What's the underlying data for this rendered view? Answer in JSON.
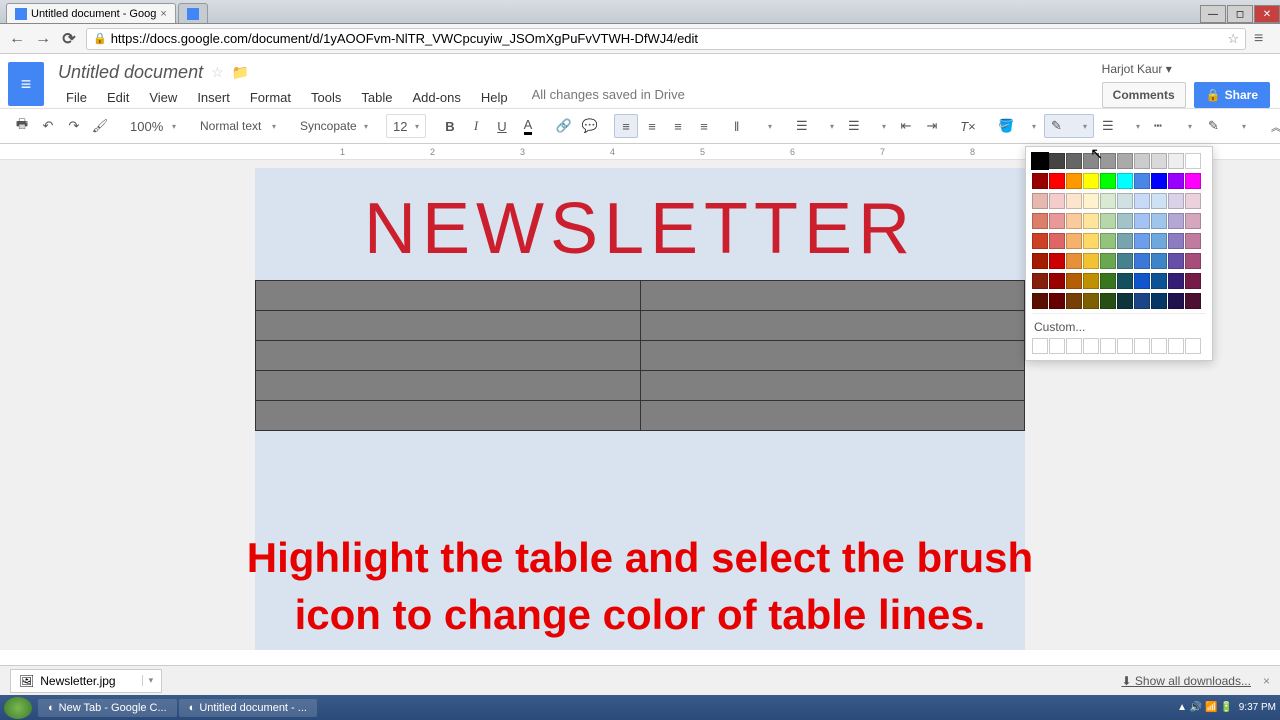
{
  "browser": {
    "tabs": [
      {
        "title": "Untitled document - Goog",
        "active": true
      }
    ],
    "url": "https://docs.google.com/document/d/1yAOOFvm-NlTR_VWCpcuyiw_JSOmXgPuFvVTWH-DfWJ4/edit"
  },
  "docs": {
    "title": "Untitled document",
    "menus": [
      "File",
      "Edit",
      "View",
      "Insert",
      "Format",
      "Tools",
      "Table",
      "Add-ons",
      "Help"
    ],
    "save_status": "All changes saved in Drive",
    "user": "Harjot Kaur",
    "comments_label": "Comments",
    "share_label": "Share"
  },
  "toolbar": {
    "zoom": "100%",
    "style": "Normal text",
    "font": "Syncopate",
    "size": "12"
  },
  "document": {
    "heading": "Newsletter",
    "table_rows": 5,
    "table_cols": 2
  },
  "color_picker": {
    "custom_label": "Custom...",
    "row_grays": [
      "#000000",
      "#444444",
      "#666666",
      "#888888",
      "#999999",
      "#aaaaaa",
      "#cccccc",
      "#d9d9d9",
      "#eeeeee",
      "#ffffff"
    ],
    "row_brights": [
      "#990000",
      "#ff0000",
      "#ff9900",
      "#ffff00",
      "#00ff00",
      "#00ffff",
      "#4a86e8",
      "#0000ff",
      "#9900ff",
      "#ff00ff"
    ],
    "grid": [
      [
        "#e6b8af",
        "#f4cccc",
        "#fce5cd",
        "#fff2cc",
        "#d9ead3",
        "#d0e0e3",
        "#c9daf8",
        "#cfe2f3",
        "#d9d2e9",
        "#ead1dc"
      ],
      [
        "#dd7e6b",
        "#ea9999",
        "#f9cb9c",
        "#ffe599",
        "#b6d7a8",
        "#a2c4c9",
        "#a4c2f4",
        "#9fc5e8",
        "#b4a7d6",
        "#d5a6bd"
      ],
      [
        "#cc4125",
        "#e06666",
        "#f6b26b",
        "#ffd966",
        "#93c47d",
        "#76a5af",
        "#6d9eeb",
        "#6fa8dc",
        "#8e7cc3",
        "#c27ba0"
      ],
      [
        "#a61c00",
        "#cc0000",
        "#e69138",
        "#f1c232",
        "#6aa84f",
        "#45818e",
        "#3c78d8",
        "#3d85c6",
        "#674ea7",
        "#a64d79"
      ],
      [
        "#85200c",
        "#990000",
        "#b45f06",
        "#bf9000",
        "#38761d",
        "#134f5c",
        "#1155cc",
        "#0b5394",
        "#351c75",
        "#741b47"
      ],
      [
        "#5b0f00",
        "#660000",
        "#783f04",
        "#7f6000",
        "#274e13",
        "#0c343d",
        "#1c4587",
        "#073763",
        "#20124d",
        "#4c1130"
      ]
    ]
  },
  "instruction": {
    "line1": "Highlight the table and select the brush",
    "line2": "icon to change color of table lines."
  },
  "downloads": {
    "item": "Newsletter.jpg",
    "show_all": "Show all downloads..."
  },
  "taskbar": {
    "items": [
      "New Tab - Google C...",
      "Untitled document - ..."
    ],
    "time": "9:37 PM"
  }
}
